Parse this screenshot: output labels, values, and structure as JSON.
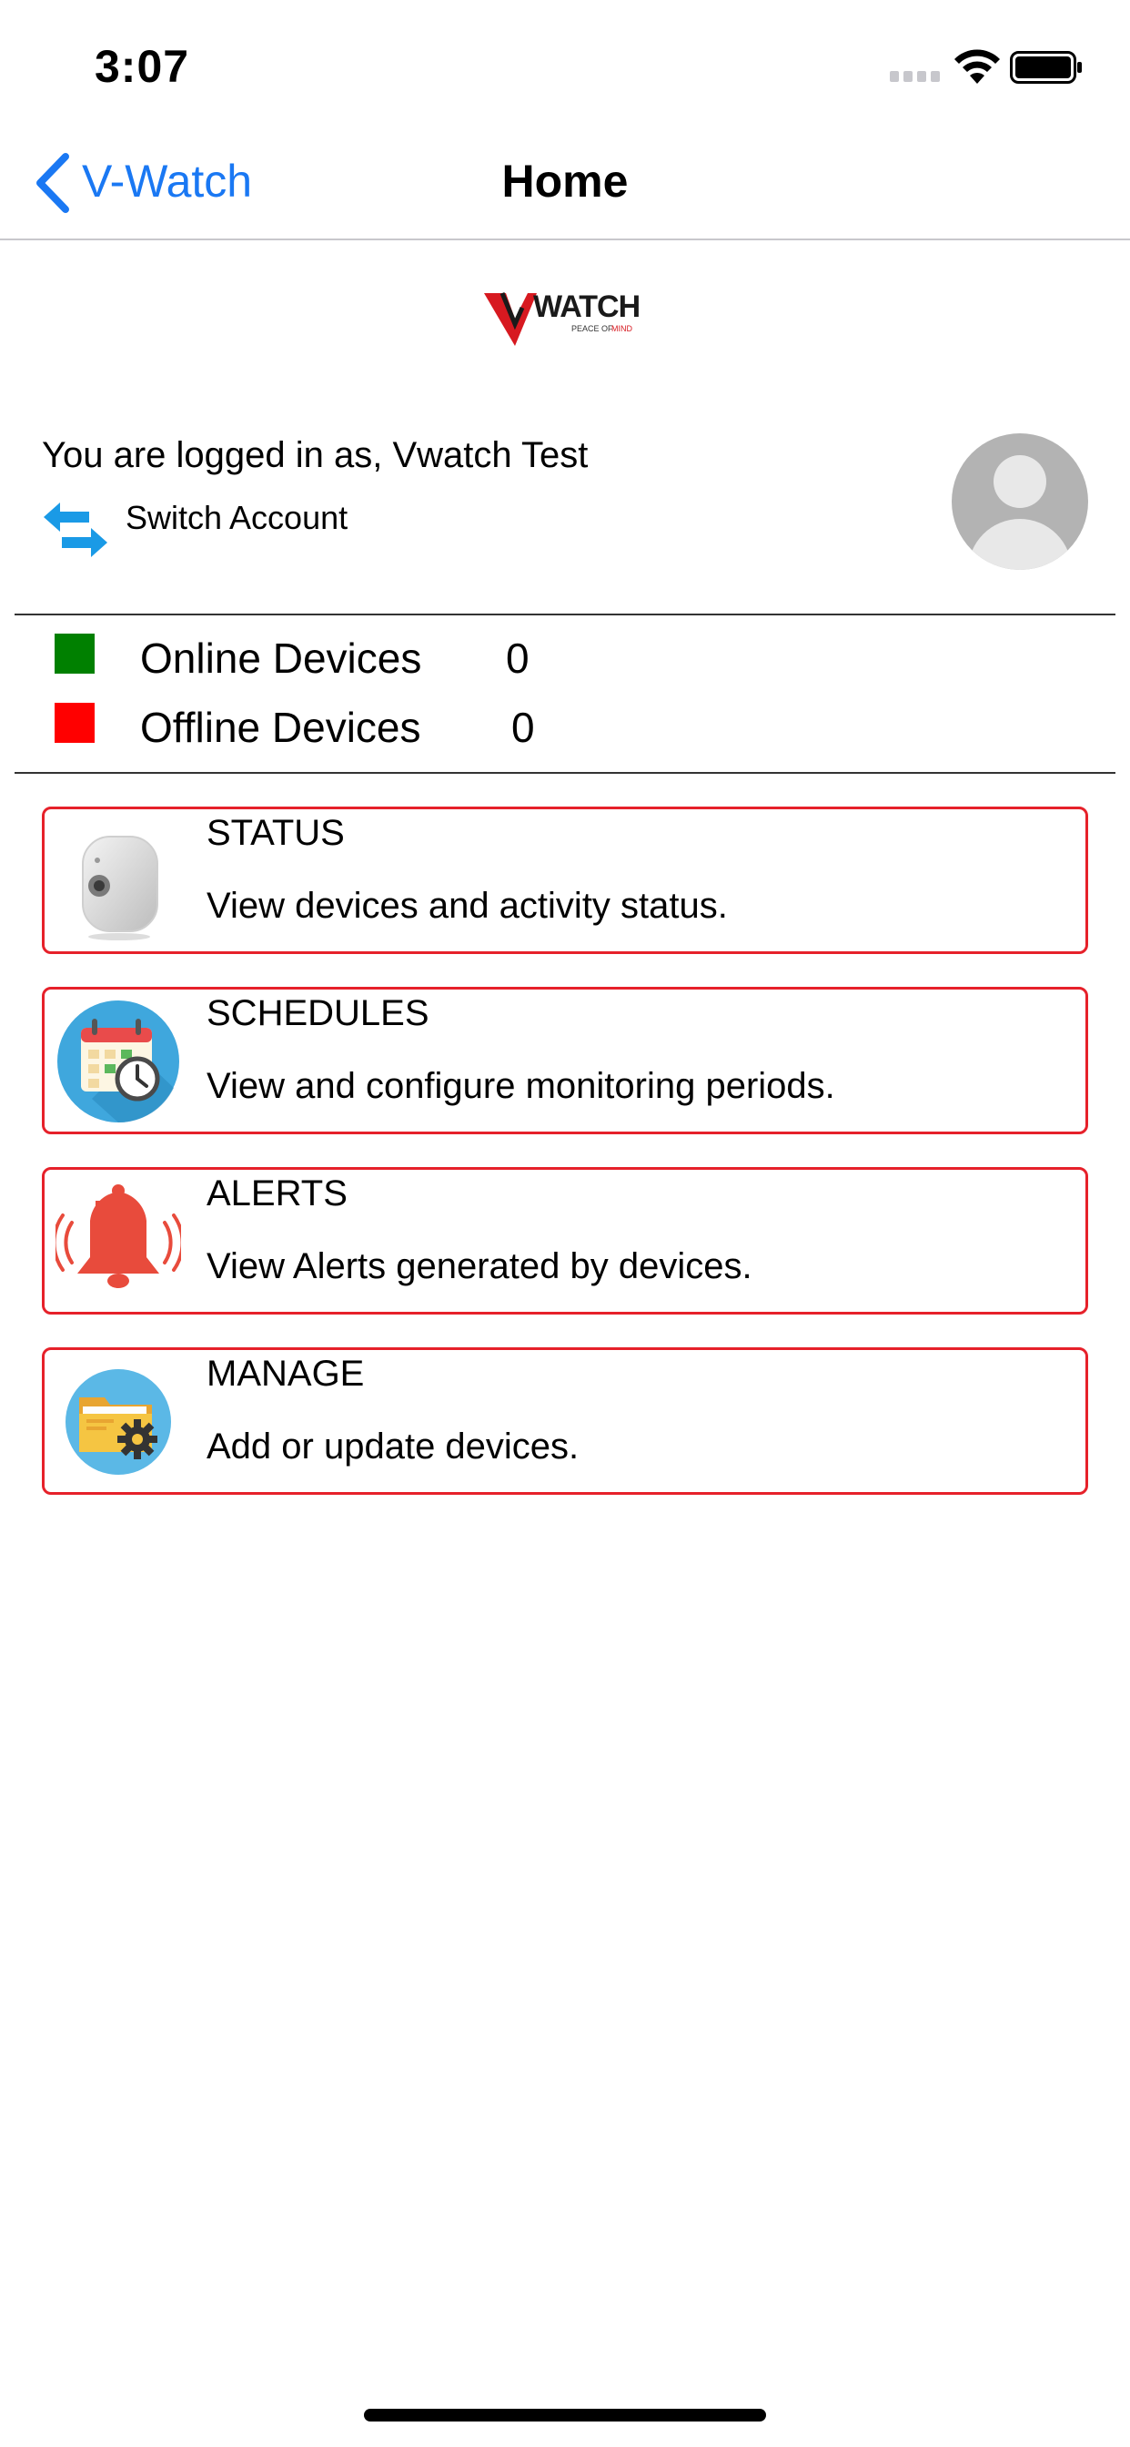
{
  "status_bar": {
    "time": "3:07"
  },
  "nav": {
    "back_label": "V-Watch",
    "title": "Home"
  },
  "logo": {
    "text": "VWATCH",
    "tagline": "PEACE OF MIND"
  },
  "user": {
    "logged_in_text": "You are logged in as, Vwatch Test",
    "switch_account_label": "Switch Account"
  },
  "devices": {
    "online": {
      "label": "Online Devices",
      "count": "0",
      "color": "#008000"
    },
    "offline": {
      "label": "Offline Devices",
      "count": "0",
      "color": "#ff0000"
    }
  },
  "menu": [
    {
      "icon": "camera-icon",
      "title": "STATUS",
      "description": "View devices and activity status."
    },
    {
      "icon": "calendar-clock-icon",
      "title": "SCHEDULES",
      "description": "View and configure monitoring periods."
    },
    {
      "icon": "bell-icon",
      "title": "ALERTS",
      "description": "View Alerts generated by devices."
    },
    {
      "icon": "folder-gear-icon",
      "title": "MANAGE",
      "description": "Add or update devices."
    }
  ],
  "colors": {
    "accent": "#1a78f3",
    "card_border": "#e6212a"
  }
}
